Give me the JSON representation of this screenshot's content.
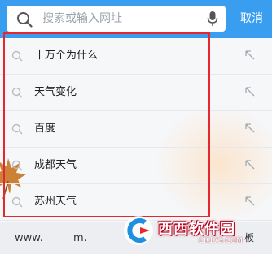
{
  "search": {
    "placeholder": "搜索或输入网址",
    "value": "",
    "cancel_label": "取消"
  },
  "suggestions": [
    {
      "label": "十万个为什么"
    },
    {
      "label": "天气变化"
    },
    {
      "label": "百度"
    },
    {
      "label": "成都天气"
    },
    {
      "label": "苏州天气"
    }
  ],
  "quickbar": {
    "items": [
      "www.",
      "m."
    ],
    "tail": "板"
  },
  "watermark": {
    "title": "西西软件园",
    "subtitle": "CR173.COM"
  },
  "colors": {
    "topbar": "#3a9ef0",
    "highlight": "#e8262d"
  }
}
